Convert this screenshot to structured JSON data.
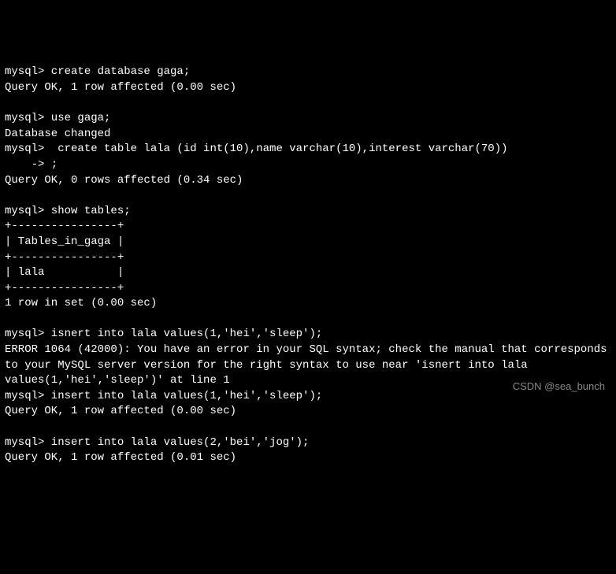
{
  "terminal": {
    "lines": [
      "mysql> create database gaga;",
      "Query OK, 1 row affected (0.00 sec)",
      "",
      "mysql> use gaga;",
      "Database changed",
      "mysql>  create table lala (id int(10),name varchar(10),interest varchar(70))",
      "    -> ;",
      "Query OK, 0 rows affected (0.34 sec)",
      "",
      "mysql> show tables;",
      "+----------------+",
      "| Tables_in_gaga |",
      "+----------------+",
      "| lala           |",
      "+----------------+",
      "1 row in set (0.00 sec)",
      "",
      "mysql> isnert into lala values(1,'hei','sleep');",
      "ERROR 1064 (42000): You have an error in your SQL syntax; check the manual that corresponds to your MySQL server version for the right syntax to use near 'isnert into lala values(1,'hei','sleep')' at line 1",
      "mysql> insert into lala values(1,'hei','sleep');",
      "Query OK, 1 row affected (0.00 sec)",
      "",
      "mysql> insert into lala values(2,'bei','jog');",
      "Query OK, 1 row affected (0.01 sec)"
    ]
  },
  "watermark": "CSDN @sea_bunch"
}
